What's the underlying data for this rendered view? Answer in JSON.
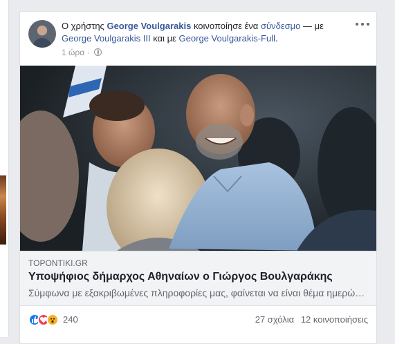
{
  "post": {
    "prefix": "Ο χρήστης",
    "author": "George Voulgarakis",
    "action": "κοινοποίησε ένα",
    "link_word": "σύνδεσμο",
    "with_text": "— με",
    "tagged_1": "George Voulgarakis III",
    "and_text": "και με",
    "tagged_2": "George Voulgarakis-Full",
    "end_punct": ".",
    "time": "1 ώρα ·",
    "privacy_icon": "globe-icon",
    "more_icon": "more-options-icon"
  },
  "link_preview": {
    "domain": "TOPONTIKI.GR",
    "headline": "Υποψήφιος δήμαρχος Αθηναίων ο Γιώργος Βουλγαράκης",
    "description": "Σύμφωνα με εξακριβωμένες πληροφορίες μας, φαίνεται να είναι θέμα ημερών..."
  },
  "engagement": {
    "reaction_icons": [
      "like-icon",
      "love-icon",
      "wow-icon"
    ],
    "reaction_count": "240",
    "comments": "27 σχόλια",
    "shares": "12 κοινοποιήσεις"
  },
  "colors": {
    "link_blue": "#365899",
    "background": "#e9ebee",
    "like": "#1877f2",
    "love": "#f33e58",
    "wow": "#f7b125"
  }
}
